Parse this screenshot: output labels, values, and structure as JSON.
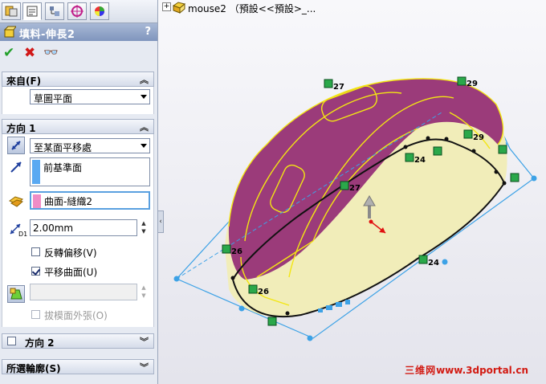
{
  "feature": {
    "title": "填料-伸長2",
    "help": "?"
  },
  "tabs": [
    "featuremanager-icon",
    "propertymanager-icon",
    "configurationmanager-icon",
    "dimxpert-icon",
    "display-manager-icon"
  ],
  "actions": {
    "ok": "✔",
    "cancel": "✖",
    "preview": "👓"
  },
  "from_group": {
    "title": "來自(F)",
    "value": "草圖平面"
  },
  "direction1": {
    "title": "方向 1",
    "end_condition": "至某面平移處",
    "reference_face": "前基準面",
    "selected_face": "曲面-縫織2",
    "offset": "2.00mm",
    "dim_label": "D1",
    "reverse_offset": "反轉偏移(V)",
    "reverse_offset_checked": false,
    "translate_surface": "平移曲面(U)",
    "translate_surface_checked": true,
    "draft_outward": "拔模面外張(O)"
  },
  "direction2": {
    "title": "方向 2",
    "checked": false
  },
  "selected_contours": {
    "title": "所選輪廓(S)"
  },
  "tree": {
    "plus": "+",
    "item": "mouse2 （預設<<預設>_..."
  },
  "labels": [
    "27",
    "29",
    "29",
    "24",
    "27",
    "26",
    "26",
    "24"
  ],
  "watermark": {
    "cn": "三维网",
    "url": "www.3dportal.cn"
  },
  "colors": {
    "title_bar": "#8fa3c7",
    "body_top": "#9b3b7a",
    "body_side": "#f1edb9",
    "edge_yellow": "#f3e612",
    "preview_blue": "#3da2e6"
  }
}
